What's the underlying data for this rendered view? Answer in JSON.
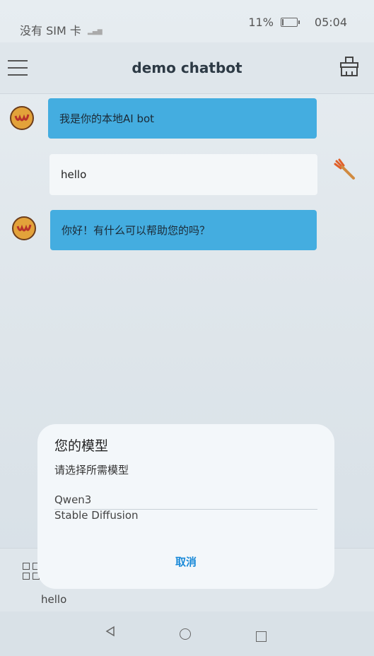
{
  "status": {
    "carrier": "没有 SIM 卡",
    "battery_percent": "11%",
    "battery_level": 0.11,
    "time": "05:04"
  },
  "appbar": {
    "title": "demo chatbot"
  },
  "messages": [
    {
      "role": "bot",
      "text": "我是你的本地AI bot"
    },
    {
      "role": "user",
      "text": "hello"
    },
    {
      "role": "bot",
      "text": "你好！有什么可以帮助您的吗？"
    }
  ],
  "input": {
    "value": "hello"
  },
  "dialog": {
    "title": "您的模型",
    "subtitle": "请选择所需模型",
    "options": [
      "Qwen3",
      "Stable Diffusion"
    ],
    "cancel_label": "取消"
  },
  "colors": {
    "accent": "#1a8ad8",
    "bot_bubble": "#44ade0",
    "user_bubble": "#f4f7f9"
  }
}
